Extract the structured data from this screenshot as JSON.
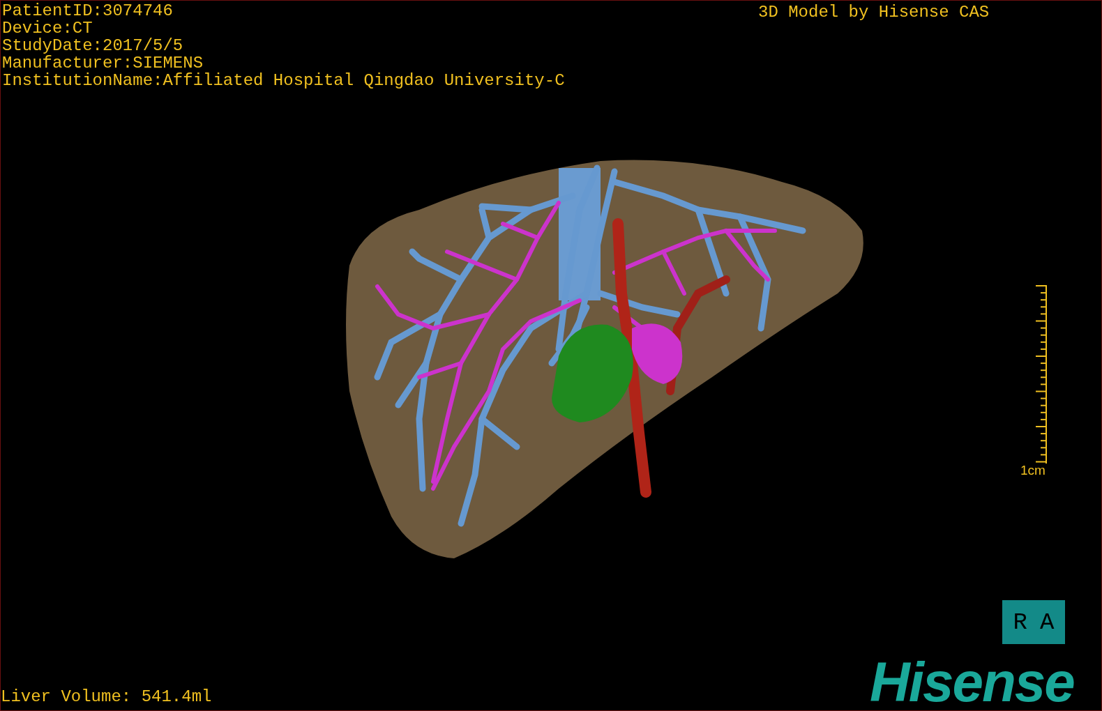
{
  "patient_info": [
    "PatientID:3074746",
    "Device:CT",
    "StudyDate:2017/5/5",
    "Manufacturer:SIEMENS",
    "InstitutionName:Affiliated Hospital Qingdao University-C"
  ],
  "model_credit": "3D Model by Hisense CAS",
  "scale_bar": {
    "label": "1cm"
  },
  "orientation_marker": {
    "labels": [
      "R",
      "A"
    ]
  },
  "logo": "Hisense",
  "liver_volume": "Liver Volume: 541.4ml"
}
